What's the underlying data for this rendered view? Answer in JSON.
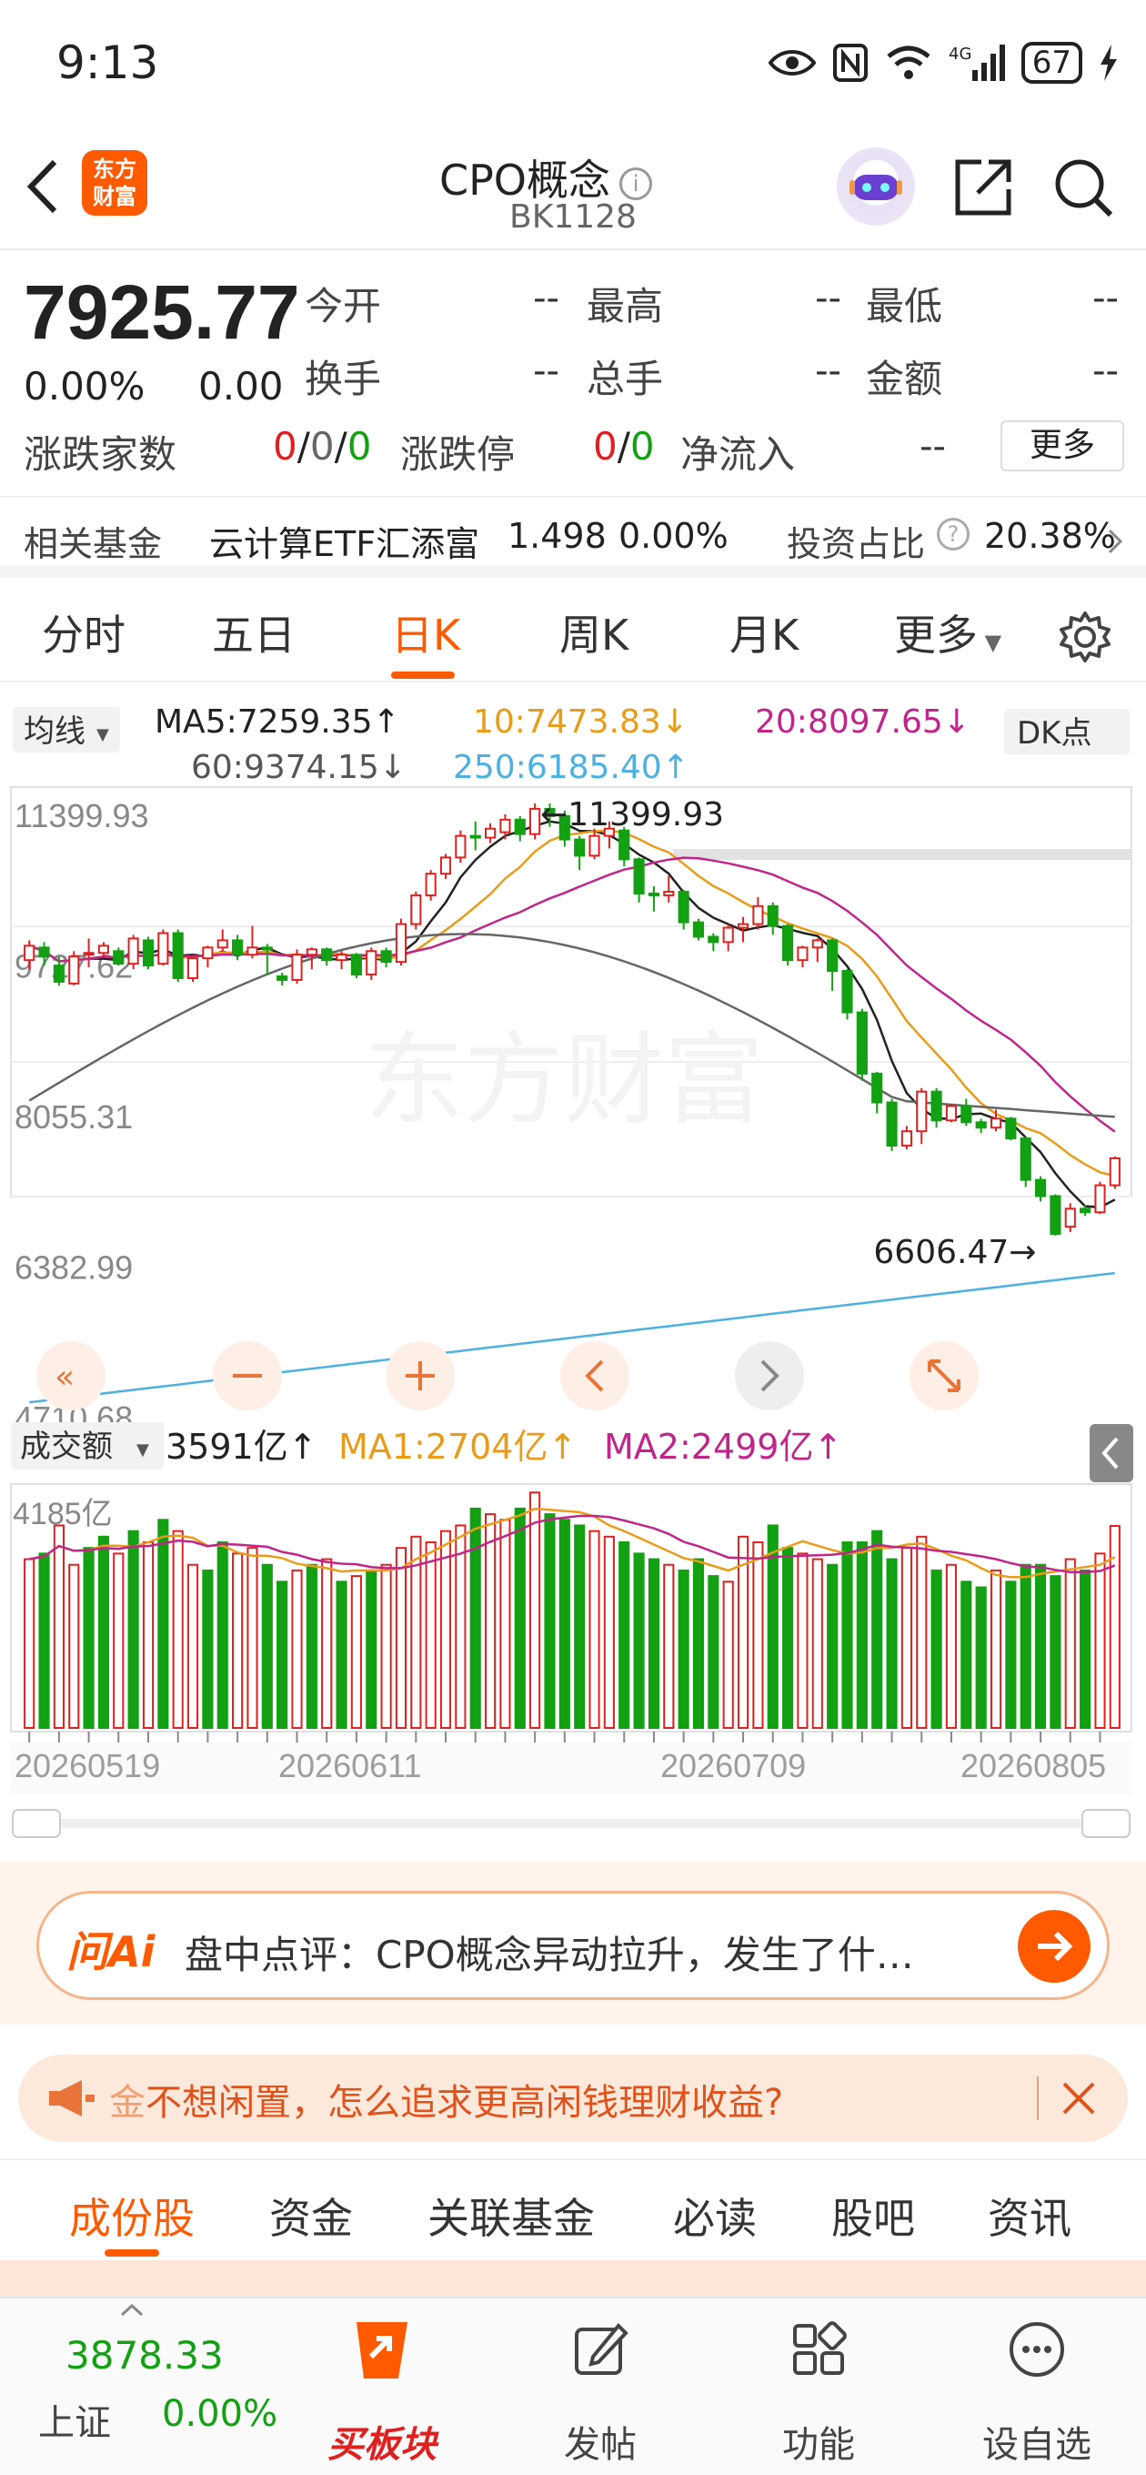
{
  "status_bar": {
    "time": "9:13",
    "battery": "67"
  },
  "header": {
    "title": "CPO概念",
    "code": "BK1128",
    "logo_text_1": "东方",
    "logo_text_2": "财富"
  },
  "quote": {
    "price": "7925.77",
    "change_pct": "0.00%",
    "change_val": "0.00",
    "fields": [
      {
        "label": "今开",
        "value": "--"
      },
      {
        "label": "最高",
        "value": "--"
      },
      {
        "label": "最低",
        "value": "--"
      },
      {
        "label": "换手",
        "value": "--"
      },
      {
        "label": "总手",
        "value": "--"
      },
      {
        "label": "金额",
        "value": "--"
      }
    ],
    "updown_label": "涨跌家数",
    "updown_a": "0",
    "updown_b": "0",
    "updown_c": "0",
    "limit_label": "涨跌停",
    "limit_a": "0",
    "limit_b": "0",
    "netflow_label": "净流入",
    "netflow_value": "--",
    "more_label": "更多"
  },
  "fund_row": {
    "label": "相关基金",
    "fund_name": "云计算ETF汇添富",
    "fund_price": "1.498",
    "fund_change": "0.00%",
    "ratio_label": "投资占比",
    "ratio_value": "20.38%"
  },
  "period_tabs": [
    "分时",
    "五日",
    "日K",
    "周K",
    "月K",
    "更多"
  ],
  "active_tab": "日K",
  "chart_data": {
    "type": "candlestick",
    "ma_selector": "均线",
    "ma_labels": {
      "ma5": "MA5:7259.35↑",
      "ma10": "10:7473.83↓",
      "ma20": "20:8097.65↓",
      "ma60": "60:9374.15↓",
      "ma250": "250:6185.40↑"
    },
    "dk_label": "DK点",
    "y_ticks": [
      "11399.93",
      "9727.62",
      "8055.31",
      "6382.99",
      "4710.68"
    ],
    "ylim": [
      4710.68,
      11399.93
    ],
    "high_annotation": "←11399.93",
    "low_annotation": "6606.47→",
    "volume_selector": "成交额",
    "volume_labels": {
      "vol": "3591亿↑",
      "ma1": "MA1:2704亿↑",
      "ma2": "MA2:2499亿↑"
    },
    "volume_top": "4185亿",
    "x_ticks": [
      "20260519",
      "20260611",
      "20260709",
      "20260805"
    ],
    "watermark": "东方财富",
    "candles": [
      [
        9660,
        9820,
        9560,
        9880
      ],
      [
        9800,
        9700,
        9600,
        9860
      ],
      [
        9600,
        9420,
        9380,
        9700
      ],
      [
        9400,
        9700,
        9380,
        9760
      ],
      [
        9720,
        9740,
        9580,
        9900
      ],
      [
        9740,
        9820,
        9700,
        9860
      ],
      [
        9760,
        9620,
        9600,
        9800
      ],
      [
        9620,
        9900,
        9560,
        9940
      ],
      [
        9880,
        9600,
        9560,
        9920
      ],
      [
        9620,
        9960,
        9600,
        10000
      ],
      [
        9960,
        9460,
        9420,
        10000
      ],
      [
        9460,
        9680,
        9420,
        9720
      ],
      [
        9680,
        9800,
        9580,
        9820
      ],
      [
        9800,
        9880,
        9760,
        10000
      ],
      [
        9880,
        9720,
        9660,
        9940
      ],
      [
        9720,
        9800,
        9680,
        10040
      ],
      [
        9800,
        9780,
        9500,
        9840
      ],
      [
        9480,
        9440,
        9380,
        9520
      ],
      [
        9440,
        9720,
        9400,
        9780
      ],
      [
        9720,
        9780,
        9560,
        9800
      ],
      [
        9780,
        9660,
        9600,
        9800
      ],
      [
        9660,
        9720,
        9560,
        9760
      ],
      [
        9720,
        9500,
        9460,
        9740
      ],
      [
        9500,
        9760,
        9440,
        9800
      ],
      [
        9760,
        9640,
        9580,
        9800
      ],
      [
        9640,
        10060,
        9600,
        10120
      ],
      [
        10060,
        10380,
        10000,
        10420
      ],
      [
        10380,
        10620,
        10320,
        10660
      ],
      [
        10620,
        10800,
        10560,
        10840
      ],
      [
        10800,
        11040,
        10740,
        11100
      ],
      [
        11040,
        11020,
        10880,
        11200
      ],
      [
        11020,
        11120,
        10960,
        11180
      ],
      [
        11080,
        11220,
        11000,
        11280
      ],
      [
        11220,
        11060,
        10980,
        11260
      ],
      [
        11060,
        11340,
        11000,
        11400
      ],
      [
        11340,
        11260,
        11140,
        11400
      ],
      [
        11260,
        11000,
        10920,
        11320
      ],
      [
        11000,
        10820,
        10660,
        11040
      ],
      [
        10820,
        11040,
        10780,
        11120
      ],
      [
        11040,
        11120,
        10900,
        11200
      ],
      [
        11100,
        10780,
        10700,
        11140
      ],
      [
        10780,
        10400,
        10300,
        10800
      ],
      [
        10400,
        10380,
        10200,
        10480
      ],
      [
        10380,
        10420,
        10300,
        10600
      ],
      [
        10420,
        10080,
        10000,
        10440
      ],
      [
        10080,
        9920,
        9880,
        10120
      ],
      [
        9920,
        9860,
        9760,
        9960
      ],
      [
        9860,
        10020,
        9760,
        10060
      ],
      [
        10020,
        10060,
        9860,
        10140
      ],
      [
        10060,
        10260,
        10000,
        10360
      ],
      [
        10260,
        10040,
        9940,
        10300
      ],
      [
        10040,
        9660,
        9600,
        10060
      ],
      [
        9660,
        9800,
        9580,
        9820
      ],
      [
        9800,
        9880,
        9640,
        9900
      ],
      [
        9880,
        9540,
        9320,
        9900
      ],
      [
        9540,
        9080,
        9000,
        9560
      ],
      [
        9080,
        8400,
        8320,
        9120
      ],
      [
        8400,
        8080,
        7960,
        8420
      ],
      [
        8080,
        7600,
        7540,
        8120
      ],
      [
        7600,
        7760,
        7560,
        7820
      ],
      [
        7760,
        8200,
        7620,
        8240
      ],
      [
        8200,
        7880,
        7800,
        8240
      ],
      [
        7880,
        8040,
        7860,
        8060
      ],
      [
        8040,
        7860,
        7820,
        8120
      ],
      [
        7860,
        7800,
        7740,
        7900
      ],
      [
        7800,
        7900,
        7760,
        8000
      ],
      [
        7900,
        7680,
        7660,
        7920
      ],
      [
        7680,
        7220,
        7140,
        7700
      ],
      [
        7220,
        7040,
        6980,
        7260
      ],
      [
        7040,
        6620,
        6600,
        7060
      ],
      [
        6700,
        6900,
        6640,
        6960
      ],
      [
        6900,
        6860,
        6820,
        6940
      ],
      [
        6860,
        7160,
        6840,
        7200
      ],
      [
        7160,
        7460,
        7120,
        7480
      ]
    ],
    "volume": [
      3000,
      3100,
      3600,
      2900,
      3200,
      3400,
      3100,
      3500,
      3300,
      3700,
      3500,
      2900,
      2800,
      3300,
      3100,
      3200,
      2900,
      2600,
      2800,
      2900,
      3000,
      2600,
      2700,
      2800,
      2900,
      3200,
      3400,
      3300,
      3500,
      3600,
      3900,
      3800,
      3700,
      3900,
      4185,
      3800,
      3700,
      3600,
      3500,
      3400,
      3300,
      3100,
      3000,
      2900,
      2800,
      3000,
      2700,
      2600,
      3400,
      3300,
      3600,
      3200,
      3100,
      3000,
      2900,
      3300,
      3300,
      3500,
      3000,
      3200,
      3400,
      2800,
      2900,
      2600,
      2500,
      2800,
      2600,
      2900,
      2900,
      2700,
      3000,
      2800,
      3100,
      3591
    ],
    "volume_up": [
      1,
      0,
      1,
      1,
      0,
      0,
      1,
      0,
      1,
      0,
      1,
      1,
      0,
      0,
      1,
      1,
      0,
      0,
      1,
      0,
      1,
      0,
      1,
      0,
      1,
      1,
      1,
      1,
      1,
      1,
      0,
      1,
      1,
      0,
      1,
      0,
      0,
      0,
      1,
      1,
      0,
      0,
      0,
      1,
      0,
      0,
      0,
      1,
      1,
      1,
      0,
      0,
      1,
      1,
      0,
      0,
      0,
      0,
      0,
      1,
      1,
      0,
      1,
      0,
      0,
      1,
      0,
      0,
      0,
      0,
      1,
      0,
      1,
      1
    ]
  },
  "ai_banner": {
    "brand": "问Ai",
    "text": "盘中点评：CPO概念异动拉升，发生了什…"
  },
  "promo": {
    "prefix": "金",
    "text": "不想闲置，怎么追求更高闲钱理财收益?"
  },
  "content_tabs": [
    "成份股",
    "资金",
    "关联基金",
    "必读",
    "股吧",
    "资讯"
  ],
  "active_content_tab": "成份股",
  "bottom_nav": {
    "index_value": "3878.33",
    "index_name": "上证",
    "index_change": "0.00%",
    "items": [
      "买板块",
      "发帖",
      "功能",
      "设自选"
    ]
  },
  "colors": {
    "accent": "#ff5a00",
    "up": "#e02020",
    "down": "#13a013"
  }
}
